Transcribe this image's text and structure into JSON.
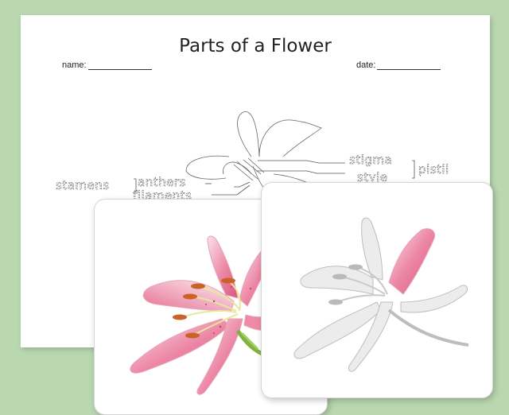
{
  "worksheet": {
    "title": "Parts of a Flower",
    "name_label": "name:",
    "date_label": "date:",
    "labels": {
      "stamens": "stamens",
      "anthers": "anthers",
      "filaments": "filaments",
      "stigma": "stigma",
      "style": "style",
      "pistil": "pistil"
    }
  },
  "colors": {
    "background": "#b9d8b0",
    "petal_pink": "#e9789a",
    "petal_light": "#f7d3de",
    "anther_orange": "#c9632a",
    "stem_green": "#7fb241",
    "gray_petal": "#dedede"
  },
  "cards": [
    {
      "name": "color-lily-card",
      "style": "full color"
    },
    {
      "name": "gray-lily-card",
      "style": "grayscale with pink highlighted petal"
    }
  ]
}
